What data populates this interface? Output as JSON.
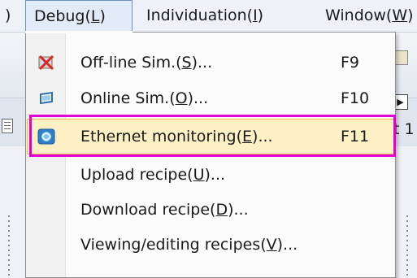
{
  "menubar": {
    "prev_fragment": ")",
    "debug": {
      "text": "Debug(",
      "key": "L",
      "close": ")"
    },
    "individuation": {
      "text": "Individuation(",
      "key": "I",
      "close": ")"
    },
    "window": {
      "text": "Window(",
      "key": "W",
      "close": ")"
    }
  },
  "background": {
    "right_text": "t 1"
  },
  "debug_menu": {
    "items": [
      {
        "text": "Off-line Sim.(",
        "key": "S",
        "tail": ")...",
        "shortcut": "F9",
        "icon": "offline-sim-icon"
      },
      {
        "text": "Online Sim.(",
        "key": "O",
        "tail": ")...",
        "shortcut": "F10",
        "icon": "online-sim-icon"
      },
      {
        "text": "Ethernet monitoring(",
        "key": "E",
        "tail": ")...",
        "shortcut": "F11",
        "icon": "ethernet-monitoring-icon",
        "highlighted": true
      },
      {
        "text": "Upload recipe(",
        "key": "U",
        "tail": ")..."
      },
      {
        "text": "Download recipe(",
        "key": "D",
        "tail": ")..."
      },
      {
        "text": "Viewing/editing recipes(",
        "key": "V",
        "tail": ")..."
      }
    ]
  },
  "colors": {
    "highlight_fill": "#fdf0c4",
    "highlight_border": "#e7b94a",
    "annotation_frame": "#e000d4"
  }
}
